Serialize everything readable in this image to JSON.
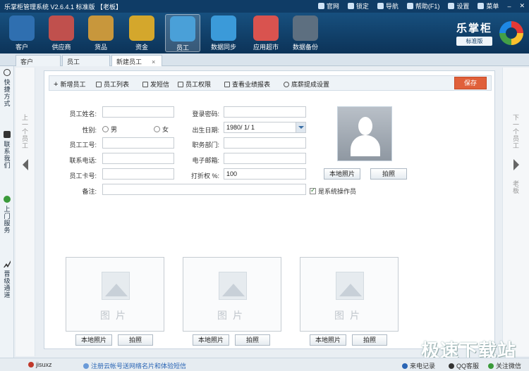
{
  "titlebar": {
    "app_title": "乐掌柜管理系统 V2.6.4.1 标准版 【老板】",
    "items": [
      "官网",
      "锁定",
      "导航",
      "帮助(F1)",
      "设置",
      "菜单"
    ]
  },
  "nav": {
    "items": [
      {
        "label": "客户",
        "color": "#2f6fb0"
      },
      {
        "label": "供应商",
        "color": "#c0504d"
      },
      {
        "label": "货品",
        "color": "#c8973c"
      },
      {
        "label": "资金",
        "color": "#d4a72c"
      },
      {
        "label": "员工",
        "color": "#4aa0d8"
      },
      {
        "label": "数据同步",
        "color": "#3b9ad9"
      },
      {
        "label": "应用超市",
        "color": "#d9534f"
      },
      {
        "label": "数据备份",
        "color": "#5d6f80"
      }
    ],
    "active_index": 4
  },
  "brand": {
    "name": "乐掌柜",
    "edition": "标准版"
  },
  "tabs": [
    {
      "label": "客户"
    },
    {
      "label": "员工"
    },
    {
      "label": "新建员工",
      "close": "×"
    }
  ],
  "sidebar": {
    "items": [
      {
        "label": "快捷方式"
      },
      {
        "label": "联系我们"
      },
      {
        "label": "上门服务"
      },
      {
        "label": "晋级通道"
      }
    ]
  },
  "prev_label": "上一个员工",
  "next_label": "下一个员工",
  "next_sub": "老板",
  "actions": [
    "新增员工",
    "员工列表",
    "发短信",
    "员工权限",
    "查看业绩报表",
    "底薪提成设置"
  ],
  "save_label": "保存",
  "form": {
    "name_label": "员工姓名:",
    "name_value": "",
    "gender_label": "性别:",
    "gender_male": "男",
    "gender_female": "女",
    "empno_label": "员工工号:",
    "phone_label": "联系电话:",
    "card_label": "员工卡号:",
    "remark_label": "备注:",
    "password_label": "登录密码:",
    "birth_label": "出生日期:",
    "birth_value": "1980/ 1/ 1",
    "dept_label": "职务部门:",
    "email_label": "电子邮箱:",
    "discount_label": "打折权 %:",
    "discount_value": "100",
    "operator_label": "是系统操作员"
  },
  "photo_buttons": {
    "local": "本地照片",
    "capture": "拍照"
  },
  "photo_placeholder": "图片",
  "status": {
    "user": "jisuxz",
    "register": "注册云帐号送网络名片和体验短信",
    "call": "来电记录",
    "qq": "QQ客服",
    "wechat": "关注微信"
  },
  "watermark": "极速下载站"
}
